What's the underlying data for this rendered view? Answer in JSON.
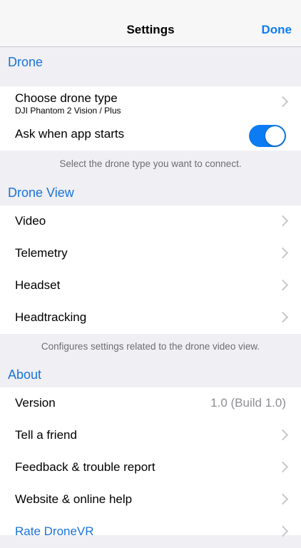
{
  "nav": {
    "title": "Settings",
    "done_label": "Done"
  },
  "drone": {
    "header": "Drone",
    "choose_label": "Choose drone type",
    "choose_sub": "DJI Phantom 2 Vision / Plus",
    "ask_label": "Ask when app starts",
    "ask_on": true,
    "footer": "Select the drone type you want to connect."
  },
  "drone_view": {
    "header": "Drone View",
    "items": [
      {
        "label": "Video"
      },
      {
        "label": "Telemetry"
      },
      {
        "label": "Headset"
      },
      {
        "label": "Headtracking"
      }
    ],
    "footer": "Configures settings related to the drone video view."
  },
  "about": {
    "header": "About",
    "version_label": "Version",
    "version_value": "1.0 (Build 1.0)",
    "items": [
      {
        "label": "Tell a friend"
      },
      {
        "label": "Feedback & trouble report"
      },
      {
        "label": "Website & online help"
      },
      {
        "label": "Rate DroneVR"
      }
    ]
  },
  "colors": {
    "accent": "#0d7cf2",
    "background": "#efeff4",
    "chevron": "#c7c7cc"
  }
}
